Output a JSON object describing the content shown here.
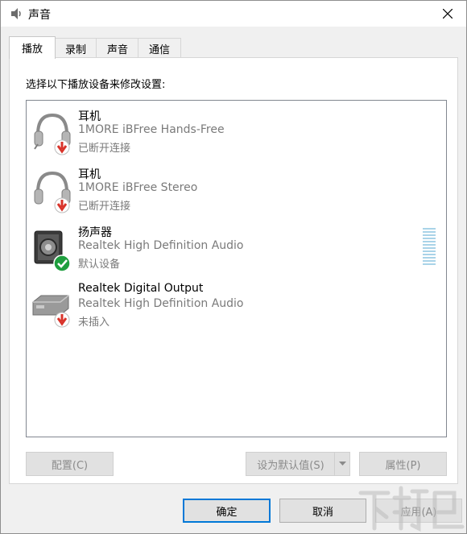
{
  "window": {
    "title": "声音"
  },
  "tabs": [
    {
      "label": "播放"
    },
    {
      "label": "录制"
    },
    {
      "label": "声音"
    },
    {
      "label": "通信"
    }
  ],
  "panel": {
    "instruction": "选择以下播放设备来修改设置:"
  },
  "devices": [
    {
      "name": "耳机",
      "description": "1MORE iBFree Hands-Free",
      "status": "已断开连接",
      "icon": "headset-disconnected-icon"
    },
    {
      "name": "耳机",
      "description": "1MORE iBFree Stereo",
      "status": "已断开连接",
      "icon": "headphones-disconnected-icon"
    },
    {
      "name": "扬声器",
      "description": "Realtek High Definition Audio",
      "status": "默认设备",
      "icon": "speaker-default-icon"
    },
    {
      "name": "Realtek Digital Output",
      "description": "Realtek High Definition Audio",
      "status": "未插入",
      "icon": "digital-output-unplugged-icon"
    }
  ],
  "buttons": {
    "configure": "配置(C)",
    "set_default": "设为默认值(S)",
    "properties": "属性(P)",
    "ok": "确定",
    "cancel": "取消",
    "apply": "应用(A)"
  },
  "colors": {
    "accent": "#0078d7",
    "disconnected": "#d9342b",
    "default_check": "#1e9e3e",
    "meter": "#a9d3e8"
  }
}
